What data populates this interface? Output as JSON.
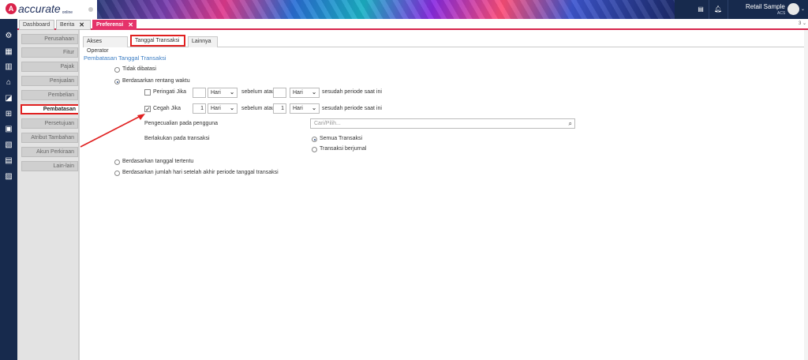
{
  "header": {
    "logo_mark": "A",
    "logo_text": "accurate",
    "logo_sub": "online",
    "user_name": "Retail Sample",
    "user_sub": "ACS",
    "icons": [
      "book-icon",
      "bell-icon"
    ]
  },
  "tabs": [
    {
      "label": "Dashboard",
      "closable": false
    },
    {
      "label": "Berita",
      "closable": true
    },
    {
      "label": "Preferensi",
      "closable": true,
      "active": true
    }
  ],
  "tab_count": "3 ⌄",
  "sidebar_icons": [
    "gear-icon",
    "building-icon",
    "book-icon",
    "bank-icon",
    "cart-icon",
    "shopping-cart-icon",
    "truck-icon",
    "factory-icon",
    "calculator-icon",
    "report-icon"
  ],
  "left_menu": [
    {
      "label": "Perusahaan"
    },
    {
      "label": "Fitur"
    },
    {
      "label": "Pajak"
    },
    {
      "label": "Penjualan"
    },
    {
      "label": "Pembelian"
    },
    {
      "label": "Pembatasan",
      "active": true
    },
    {
      "label": "Persetujuan"
    },
    {
      "label": "Atribut Tambahan"
    },
    {
      "label": "Akun Perkiraan"
    },
    {
      "label": "Lain-lain"
    }
  ],
  "sub_tabs": [
    {
      "label": "Akses Operator"
    },
    {
      "label": "Tanggal Transaksi",
      "active": true
    },
    {
      "label": "Lainnya"
    }
  ],
  "section_title": "Pembatasan Tanggal Transaksi",
  "options": {
    "tidak_dibatasi": "Tidak dibatasi",
    "rentang_waktu": "Berdasarkan rentang waktu",
    "tanggal_tertentu": "Berdasarkan tanggal tertentu",
    "jumlah_hari": "Berdasarkan jumlah hari setelah akhir periode tanggal transaksi",
    "selected": "rentang_waktu"
  },
  "peringati": {
    "label": "Peringati Jika",
    "checked": false,
    "before_value": "",
    "before_unit": "Hari",
    "between": "sebelum atau",
    "after_value": "",
    "after_unit": "Hari",
    "suffix": "sesudah periode saat ini"
  },
  "cegah": {
    "label": "Cegah Jika",
    "checked": true,
    "before_value": "1",
    "before_unit": "Hari",
    "between": "sebelum atau",
    "after_value": "1",
    "after_unit": "Hari",
    "suffix": "sesudah periode saat ini"
  },
  "pengecualian": {
    "label": "Pengecualian pada pengguna",
    "placeholder": "Cari/Pilih..."
  },
  "berlakukan": {
    "label": "Berlakukan pada transaksi",
    "semua": "Semua Transaksi",
    "berjurnal": "Transaksi berjurnal",
    "selected": "semua"
  },
  "colors": {
    "accent": "#e5336a",
    "nav": "#172a4d",
    "section_title": "#3b7dc4",
    "highlight": "#e02020"
  }
}
